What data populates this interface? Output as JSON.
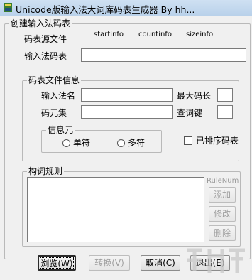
{
  "window": {
    "title": "Unicode版输入法大词库码表生成器 By hh..."
  },
  "create_group": {
    "legend": "创建输入法码表",
    "source_label": "码表源文件",
    "col_startinfo": "startinfo",
    "col_countinfo": "countinfo",
    "col_sizeinfo": "sizeinfo",
    "output_label": "输入法码表",
    "output_value": ""
  },
  "info_group": {
    "legend": "码表文件信息",
    "ime_name_label": "输入法名",
    "ime_name_value": "",
    "max_code_label": "最大码长",
    "max_code_value": "",
    "charset_label": "码元集",
    "charset_value": "",
    "query_key_label": "查词键",
    "query_key_value": ""
  },
  "info_element": {
    "legend": "信息元",
    "single_label": "单符",
    "multi_label": "多符"
  },
  "sorted_checkbox_label": "已排序码表",
  "rules_group": {
    "legend": "构词规则",
    "rulenum_label": "RuleNum",
    "add_label": "添加",
    "modify_label": "修改",
    "delete_label": "删除"
  },
  "buttons": {
    "browse": "浏览(W)",
    "convert": "转换(V)",
    "cancel": "取消(C)",
    "exit": "退出(E)"
  }
}
